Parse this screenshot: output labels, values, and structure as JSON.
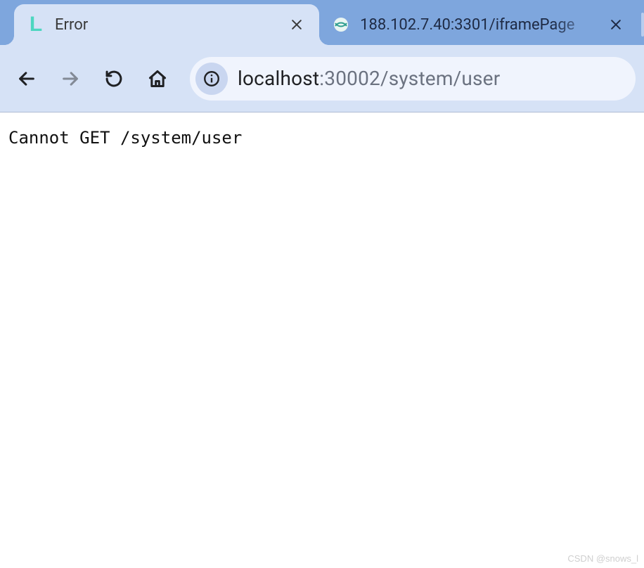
{
  "tabs": [
    {
      "title": "Error",
      "active": true
    },
    {
      "title": "188.102.7.40:3301/iframePage",
      "active": false
    }
  ],
  "address": {
    "host": "localhost",
    "rest": ":30002/system/user"
  },
  "page": {
    "error_message": "Cannot GET /system/user"
  },
  "watermark": "CSDN @snows_l"
}
